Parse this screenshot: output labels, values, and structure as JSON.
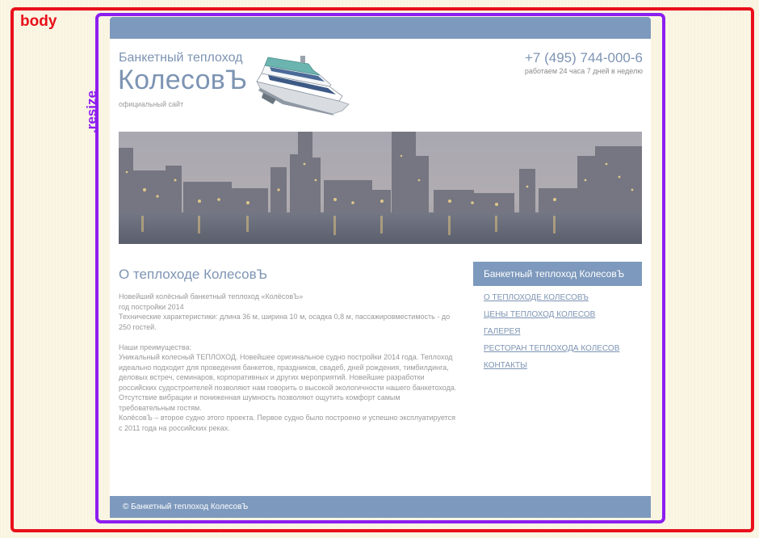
{
  "debug": {
    "body_label": "body",
    "resize_label": ".resize",
    "body_outline_color": "#e8101a",
    "resize_outline_color": "#8c1ef0"
  },
  "colors": {
    "accent": "#7d99bd",
    "text_accent": "#7d94b3",
    "background": "#fbf5e3"
  },
  "header": {
    "subtitle": "Банкетный теплоход",
    "title": "КолесовЪ",
    "official": "официальный сайт",
    "logo_icon": "ship-icon",
    "phone": "+7 (495) 744-000-6",
    "hours": "работаем 24 часа 7 дней в неделю"
  },
  "hero": {
    "icon": "night-city-photo"
  },
  "main": {
    "heading": "О теплоходе КолесовЪ",
    "paragraphs": [
      "Новейший колёсный банкетный теплоход «КолёсовЪ»",
      "год постройки 2014",
      "Технические характеристики:  длина 36 м, ширина 10 м, осадка 0,8 м, пассажировместимость - до 250 гостей.",
      "",
      "Наши преимущества:",
      "Уникальный колесный ТЕПЛОХОД. Новейшее оригинальное судно постройки 2014 года. Теплоход идеально подходит для проведения банкетов, праздников, свадеб, дней рождения, тимбилдинга, деловых встреч, семинаров, корпоративных и других мероприятий. Новейшие разработки российских судостроителей позволяют нам говорить о высокой экологичности нашего банкетохода. Отсутствие вибрации и пониженная шумность позволяют ощутить комфорт самым требовательным гостям.",
      "КолёсовЪ – второе судно этого проекта. Первое судно было построено и успешно эксплуатируется с 2011 года на российских реках."
    ]
  },
  "sidebar": {
    "header": "Банкетный теплоход КолесовЪ",
    "items": [
      {
        "label": "О ТЕПЛОХОДЕ КОЛЕСОВЪ"
      },
      {
        "label": "ЦЕНЫ ТЕПЛОХОД КОЛЕСОВ"
      },
      {
        "label": "ГАЛЕРЕЯ"
      },
      {
        "label": "РЕСТОРАН ТЕПЛОХОДА КОЛЕСОВ"
      },
      {
        "label": "КОНТАКТЫ"
      }
    ]
  },
  "footer": {
    "text": "© Банкетный теплоход КолесовЪ"
  }
}
